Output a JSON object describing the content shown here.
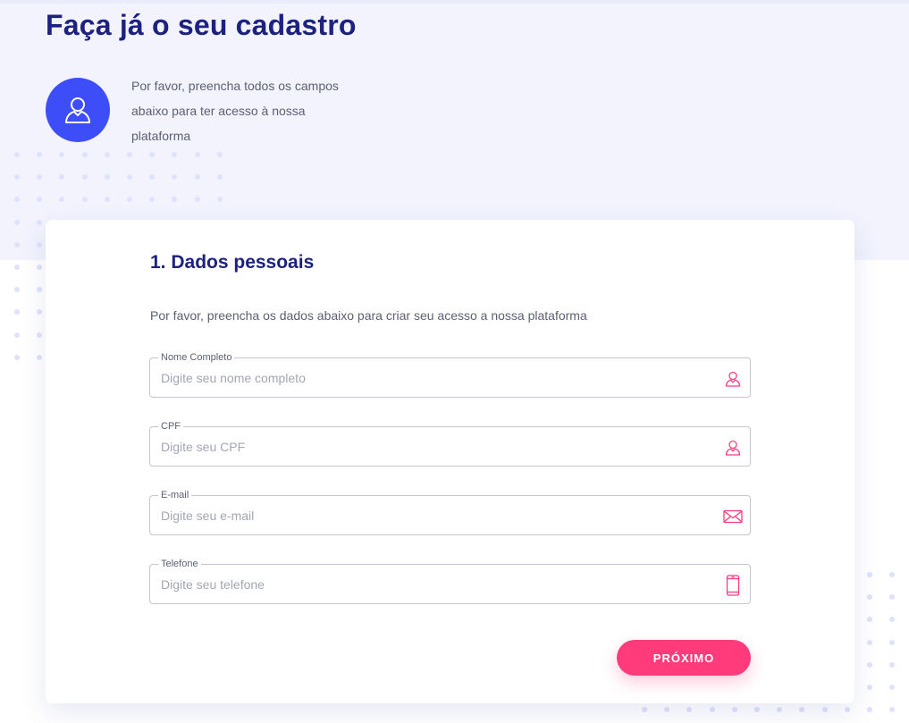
{
  "header": {
    "title": "Faça já o seu cadastro",
    "intro": "Por favor, preencha todos os campos abaixo para ter acesso à nossa plataforma",
    "avatar_icon": "user-icon"
  },
  "form": {
    "section_title": "1. Dados pessoais",
    "section_description": "Por favor, preencha os dados abaixo para criar seu acesso a nossa plataforma",
    "fields": [
      {
        "label": "Nome Completo",
        "placeholder": "Digite seu nome completo",
        "value": "",
        "icon": "user-icon"
      },
      {
        "label": "CPF",
        "placeholder": "Digite seu CPF",
        "value": "",
        "icon": "user-icon"
      },
      {
        "label": "E-mail",
        "placeholder": "Digite seu e-mail",
        "value": "",
        "icon": "envelope-icon"
      },
      {
        "label": "Telefone",
        "placeholder": "Digite seu telefone",
        "value": "",
        "icon": "phone-icon"
      }
    ],
    "next_label": "PRÓXIMO"
  },
  "colors": {
    "primary": "#1d2180",
    "avatar_blue": "#3d4ef8",
    "accent_pink": "#ff3b7c",
    "band": "#f2f3fd"
  }
}
